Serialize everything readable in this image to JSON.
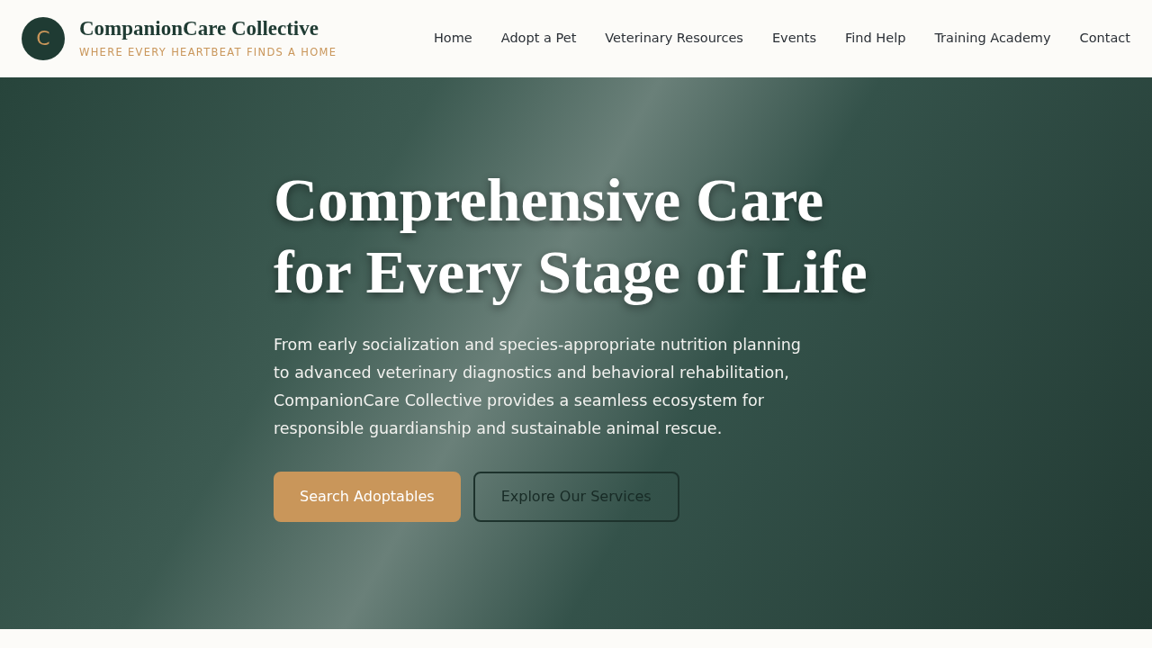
{
  "brand": {
    "logo_letter": "C",
    "name": "CompanionCare Collective",
    "tagline": "WHERE EVERY HEARTBEAT FINDS A HOME"
  },
  "nav": [
    {
      "label": "Home"
    },
    {
      "label": "Adopt a Pet"
    },
    {
      "label": "Veterinary Resources"
    },
    {
      "label": "Events"
    },
    {
      "label": "Find Help"
    },
    {
      "label": "Training Academy"
    },
    {
      "label": "Contact"
    }
  ],
  "hero": {
    "title_lines": [
      "Comprehensive Care",
      "for Every Stage of Life"
    ],
    "text": "From early socialization and species-appropriate nutrition planning to advanced veterinary diagnostics and behavioral rehabilitation, CompanionCare Collective provides a seamless ecosystem for responsible guardianship and sustainable animal rescue.",
    "buttons": [
      {
        "label": "Search Adoptables",
        "kind": "primary"
      },
      {
        "label": "Explore Our Services",
        "kind": "outline"
      }
    ]
  }
}
